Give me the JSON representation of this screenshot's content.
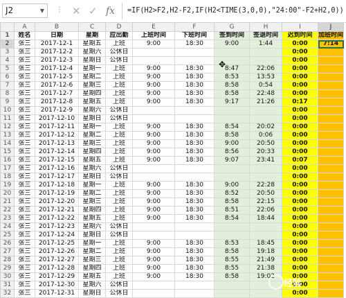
{
  "namebox": "J2",
  "formula": "=IF(H2>F2,H2-F2,IF(H2<TIME(3,0,0),\"24:00\"-F2+H2,0))",
  "columns": [
    "A",
    "B",
    "C",
    "D",
    "E",
    "F",
    "G",
    "H",
    "I",
    "J"
  ],
  "header": [
    "姓名",
    "日期",
    "星期",
    "应出勤",
    "上班时间",
    "下班时间",
    "签到时间",
    "签退时间",
    "迟到时间",
    "加班时间"
  ],
  "rows": [
    [
      "张三",
      "2017-12-1",
      "星期五",
      "上班",
      "9:00",
      "18:30",
      "9:00",
      "1:44",
      "0:00",
      "7:14"
    ],
    [
      "张三",
      "2017-12-2",
      "星期六",
      "公休日",
      "",
      "",
      "",
      "",
      "0:00",
      ""
    ],
    [
      "张三",
      "2017-12-3",
      "星期日",
      "公休日",
      "",
      "",
      "",
      "",
      "0:00",
      ""
    ],
    [
      "张三",
      "2017-12-4",
      "星期一",
      "上班",
      "9:00",
      "18:30",
      "8:47",
      "22:06",
      "0:00",
      ""
    ],
    [
      "张三",
      "2017-12-5",
      "星期二",
      "上班",
      "9:00",
      "18:30",
      "8:53",
      "13:53",
      "0:00",
      ""
    ],
    [
      "张三",
      "2017-12-6",
      "星期三",
      "上班",
      "9:00",
      "18:30",
      "8:58",
      "0:54",
      "0:00",
      ""
    ],
    [
      "张三",
      "2017-12-7",
      "星期四",
      "上班",
      "9:00",
      "18:30",
      "8:58",
      "22:48",
      "0:00",
      ""
    ],
    [
      "张三",
      "2017-12-8",
      "星期五",
      "上班",
      "9:00",
      "18:30",
      "9:17",
      "21:26",
      "0:17",
      ""
    ],
    [
      "张三",
      "2017-12-9",
      "星期六",
      "公休日",
      "",
      "",
      "",
      "",
      "0:00",
      ""
    ],
    [
      "张三",
      "2017-12-10",
      "星期日",
      "公休日",
      "",
      "",
      "",
      "",
      "0:00",
      ""
    ],
    [
      "张三",
      "2017-12-11",
      "星期一",
      "上班",
      "9:00",
      "18:30",
      "8:54",
      "20:02",
      "0:00",
      ""
    ],
    [
      "张三",
      "2017-12-12",
      "星期二",
      "上班",
      "9:00",
      "18:30",
      "8:58",
      "0:06",
      "0:00",
      ""
    ],
    [
      "张三",
      "2017-12-13",
      "星期三",
      "上班",
      "9:00",
      "18:30",
      "9:00",
      "20:50",
      "0:00",
      ""
    ],
    [
      "张三",
      "2017-12-14",
      "星期四",
      "上班",
      "9:00",
      "18:30",
      "8:56",
      "20:33",
      "0:00",
      ""
    ],
    [
      "张三",
      "2017-12-15",
      "星期五",
      "上班",
      "9:00",
      "18:30",
      "9:07",
      "23:41",
      "0:07",
      ""
    ],
    [
      "张三",
      "2017-12-16",
      "星期六",
      "公休日",
      "",
      "",
      "",
      "",
      "0:00",
      ""
    ],
    [
      "张三",
      "2017-12-17",
      "星期日",
      "公休日",
      "",
      "",
      "",
      "",
      "0:00",
      ""
    ],
    [
      "张三",
      "2017-12-18",
      "星期一",
      "上班",
      "9:00",
      "18:30",
      "9:00",
      "22:28",
      "0:00",
      ""
    ],
    [
      "张三",
      "2017-12-19",
      "星期二",
      "上班",
      "9:00",
      "18:30",
      "8:52",
      "20:50",
      "0:00",
      ""
    ],
    [
      "张三",
      "2017-12-20",
      "星期三",
      "上班",
      "9:00",
      "18:30",
      "8:58",
      "22:15",
      "0:00",
      ""
    ],
    [
      "张三",
      "2017-12-21",
      "星期四",
      "上班",
      "9:00",
      "18:30",
      "8:51",
      "22:06",
      "0:00",
      ""
    ],
    [
      "张三",
      "2017-12-22",
      "星期五",
      "上班",
      "9:00",
      "18:30",
      "8:54",
      "18:44",
      "0:00",
      ""
    ],
    [
      "张三",
      "2017-12-23",
      "星期六",
      "公休日",
      "",
      "",
      "",
      "",
      "0:00",
      ""
    ],
    [
      "张三",
      "2017-12-24",
      "星期日",
      "公休日",
      "",
      "",
      "",
      "",
      "0:00",
      ""
    ],
    [
      "张三",
      "2017-12-25",
      "星期一",
      "上班",
      "9:00",
      "18:30",
      "8:53",
      "18:45",
      "0:00",
      ""
    ],
    [
      "张三",
      "2017-12-26",
      "星期二",
      "上班",
      "9:00",
      "18:30",
      "8:58",
      "19:18",
      "0:00",
      ""
    ],
    [
      "张三",
      "2017-12-27",
      "星期三",
      "上班",
      "9:00",
      "18:30",
      "8:55",
      "21:49",
      "0:00",
      ""
    ],
    [
      "张三",
      "2017-12-28",
      "星期四",
      "上班",
      "9:00",
      "18:30",
      "8:55",
      "21:38",
      "0:00",
      ""
    ],
    [
      "张三",
      "2017-12-29",
      "星期五",
      "上班",
      "9:00",
      "18:30",
      "8:58",
      "19:02",
      "0:00",
      ""
    ],
    [
      "张三",
      "2017-12-30",
      "星期六",
      "公休日",
      "",
      "",
      "",
      "",
      "0:00",
      ""
    ],
    [
      "张三",
      "2017-12-31",
      "星期日",
      "公休日",
      "",
      "",
      "",
      "",
      "0:00",
      ""
    ]
  ],
  "watermark": "经验",
  "colors": {
    "green": "#e2efda",
    "yellow": "#ffff00",
    "orange": "#ffc000",
    "selection": "#217346"
  }
}
